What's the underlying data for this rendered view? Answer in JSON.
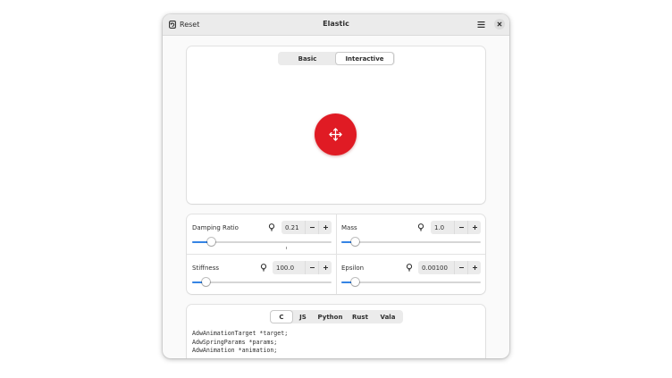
{
  "window": {
    "title": "Elastic",
    "reset_label": "Reset"
  },
  "icons": {
    "reset": "reset-icon",
    "menu": "hamburger-menu-icon",
    "close": "close-icon",
    "move": "move-arrows-icon",
    "hint": "lightbulb-icon",
    "minus": "minus-icon",
    "plus": "plus-icon"
  },
  "preview": {
    "modes": [
      {
        "label": "Basic",
        "active": false
      },
      {
        "label": "Interactive",
        "active": true
      }
    ],
    "ball_color": "#e01b24"
  },
  "controls": {
    "damping": {
      "label": "Damping Ratio",
      "value": "0.21",
      "level": 0.14,
      "mark": 0.67
    },
    "mass": {
      "label": "Mass",
      "value": "1.0",
      "level": 0.1
    },
    "stiffness": {
      "label": "Stiffness",
      "value": "100.0",
      "level": 0.1
    },
    "epsilon": {
      "label": "Epsilon",
      "value": "0.00100",
      "level": 0.1
    }
  },
  "code": {
    "languages": [
      {
        "label": "C",
        "active": true
      },
      {
        "label": "JS",
        "active": false
      },
      {
        "label": "Python",
        "active": false
      },
      {
        "label": "Rust",
        "active": false
      },
      {
        "label": "Vala",
        "active": false
      }
    ],
    "lines": [
      "AdwAnimationTarget *target;",
      "AdwSpringParams *params;",
      "AdwAnimation *animation;"
    ]
  },
  "accent_color": "#3584e4"
}
